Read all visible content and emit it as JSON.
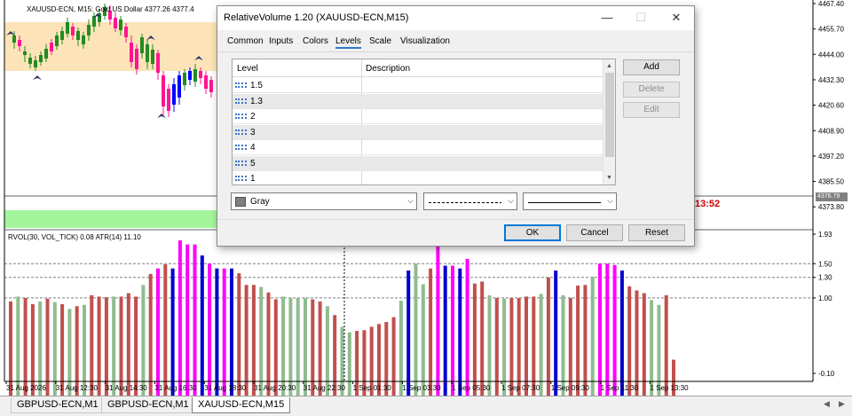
{
  "chart_window": {
    "price_title": "XAUUSD-ECN, M15:  Gold US Dollar  4377.26  4377.4",
    "indicator_title": "RVOL(30, VOL_TICK) 0.08 ATR(14) 11.10",
    "current_price": "4376.79",
    "clock": "13:52",
    "price_axis": [
      "4467.40",
      "4455.70",
      "4444.00",
      "4432.30",
      "4420.60",
      "4408.90",
      "4397.20",
      "4385.50",
      "4373.80"
    ],
    "indicator_axis": [
      "1.93",
      "1.50",
      "1.30",
      "1.00",
      "-0.10"
    ],
    "time_axis": [
      "31 Aug 2026",
      "31 Aug 12:30",
      "31 Aug 14:30",
      "31 Aug 16:30",
      "31 Aug 18:30",
      "31 Aug 20:30",
      "31 Aug 22:30",
      "1 Sep 01:30",
      "1 Sep 03:30",
      "1 Sep 05:30",
      "1 Sep 07:30",
      "1 Sep 09:30",
      "1 Sep 11:30",
      "1 Sep 13:30"
    ],
    "level_lines": [
      1.5,
      1.3,
      1.0
    ],
    "colors": {
      "bull_candle": "#228b22",
      "bear_candle": "#ff1493",
      "blue_candle": "#0000ff",
      "session_band": "#fce4b8",
      "green_strip": "#a4f49c",
      "bar_red": "#c0504d",
      "bar_green": "#8fbc8f",
      "bar_magenta": "#ff00ff",
      "bar_blue": "#0000cd",
      "price_label_bg": "#808080",
      "clock_text": "#d00000"
    }
  },
  "chart_data": {
    "type": "bar",
    "title": "RVOL(30, VOL_TICK) 0.08 ATR(14) 11.10",
    "xlabel": "",
    "ylabel": "",
    "ylim": [
      -0.1,
      1.93
    ],
    "values": [
      0.95,
      1.02,
      1.0,
      0.91,
      0.95,
      0.99,
      0.94,
      0.91,
      0.84,
      0.88,
      0.9,
      1.04,
      1.02,
      1.01,
      1.02,
      1.02,
      1.07,
      1.02,
      1.19,
      1.35,
      1.43,
      1.49,
      1.43,
      1.84,
      1.78,
      1.78,
      1.62,
      1.5,
      1.43,
      1.43,
      1.43,
      1.36,
      1.19,
      1.19,
      1.16,
      1.08,
      0.98,
      1.02,
      1.0,
      1.0,
      1.0,
      0.98,
      0.95,
      0.88,
      0.75,
      0.58,
      0.5,
      0.52,
      0.53,
      0.58,
      0.62,
      0.65,
      0.72,
      0.96,
      1.4,
      1.5,
      1.2,
      1.43,
      1.79,
      1.47,
      1.47,
      1.43,
      1.57,
      1.21,
      1.24,
      1.04,
      1.0,
      0.99,
      1.0,
      1.0,
      1.02,
      1.02,
      1.06,
      1.3,
      1.4,
      1.04,
      1.0,
      1.18,
      1.19,
      1.31,
      1.5,
      1.5,
      1.48,
      1.4,
      1.17,
      1.11,
      1.07,
      0.97,
      0.9,
      1.04,
      0.1
    ],
    "colors": [
      "red",
      "green",
      "red",
      "red",
      "green",
      "red",
      "green",
      "red",
      "green",
      "red",
      "green",
      "red",
      "red",
      "red",
      "green",
      "red",
      "red",
      "red",
      "green",
      "red",
      "magenta",
      "red",
      "blue",
      "magenta",
      "magenta",
      "magenta",
      "blue",
      "magenta",
      "blue",
      "magenta",
      "blue",
      "red",
      "red",
      "red",
      "green",
      "red",
      "red",
      "green",
      "green",
      "green",
      "green",
      "red",
      "red",
      "green",
      "red",
      "green",
      "green",
      "red",
      "red",
      "red",
      "red",
      "red",
      "red",
      "green",
      "blue",
      "green",
      "green",
      "red",
      "magenta",
      "blue",
      "magenta",
      "blue",
      "magenta",
      "red",
      "red",
      "green",
      "red",
      "green",
      "red",
      "red",
      "red",
      "red",
      "green",
      "red",
      "blue",
      "green",
      "red",
      "red",
      "red",
      "green",
      "magenta",
      "magenta",
      "magenta",
      "blue",
      "red",
      "red",
      "red",
      "green",
      "green",
      "red",
      "red"
    ],
    "levels": [
      1.5,
      1.3,
      1.0
    ]
  },
  "dialog": {
    "title": "RelativeVolume 1.20 (XAUUSD-ECN,M15)",
    "window_buttons": [
      "minimize-icon",
      "maximize-icon",
      "close-icon"
    ],
    "tabs": [
      {
        "label": "Common",
        "active": false
      },
      {
        "label": "Inputs",
        "active": false
      },
      {
        "label": "Colors",
        "active": false
      },
      {
        "label": "Levels",
        "active": true
      },
      {
        "label": "Scale",
        "active": false
      },
      {
        "label": "Visualization",
        "active": false
      }
    ],
    "table": {
      "col_level": "Level",
      "col_description": "Description",
      "rows": [
        {
          "level": "1.5",
          "description": ""
        },
        {
          "level": "1.3",
          "description": ""
        },
        {
          "level": "2",
          "description": ""
        },
        {
          "level": "3",
          "description": ""
        },
        {
          "level": "4",
          "description": ""
        },
        {
          "level": "5",
          "description": ""
        },
        {
          "level": "1",
          "description": ""
        }
      ]
    },
    "buttons": {
      "add": "Add",
      "delete": "Delete",
      "edit": "Edit",
      "ok": "OK",
      "cancel": "Cancel",
      "reset": "Reset"
    },
    "color_select": {
      "value": "Gray",
      "swatch": "#808080"
    },
    "style_select": "dashed",
    "width_select": "solid"
  },
  "symbol_tabs": [
    {
      "label": "GBPUSD-ECN,M1",
      "active": false
    },
    {
      "label": "GBPUSD-ECN,M1",
      "active": false
    },
    {
      "label": "XAUUSD-ECN,M15",
      "active": true
    }
  ]
}
